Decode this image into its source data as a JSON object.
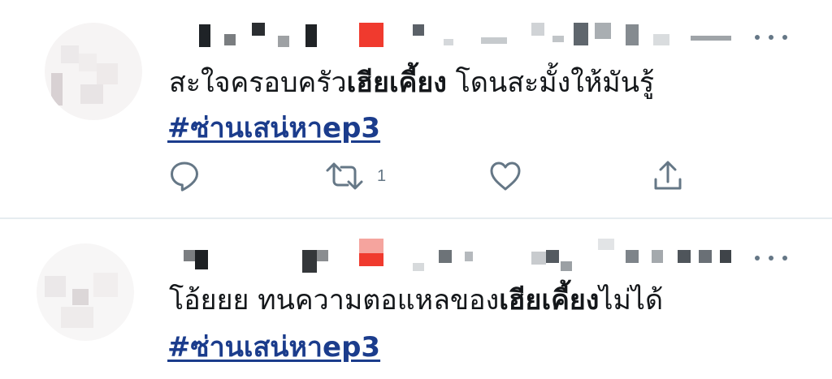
{
  "tweets": [
    {
      "text_before": "สะใจครอบครัว",
      "text_bold": "เฮียเคี้ยง",
      "text_after": " โดนสะมั้งให้มันรู้",
      "hashtag": "#ซ่านเสน่หาep3",
      "actions": {
        "reply_icon": "reply-icon",
        "retweet_icon": "retweet-icon",
        "retweet_count": "1",
        "like_icon": "heart-icon",
        "share_icon": "share-icon"
      },
      "more_icon": "more-icon"
    },
    {
      "text_before": "โอ้ยยย ทนความตอแหลของ",
      "text_bold": "เฮียเคี้ยง",
      "text_after": "ไม่ได้",
      "hashtag": "#ซ่านเสน่หาep3",
      "more_icon": "more-icon"
    }
  ],
  "colors": {
    "hashtag": "#1b3c8c",
    "icon": "#657786",
    "divider": "#e6ecf0",
    "censor_red": "#f03a2e"
  }
}
